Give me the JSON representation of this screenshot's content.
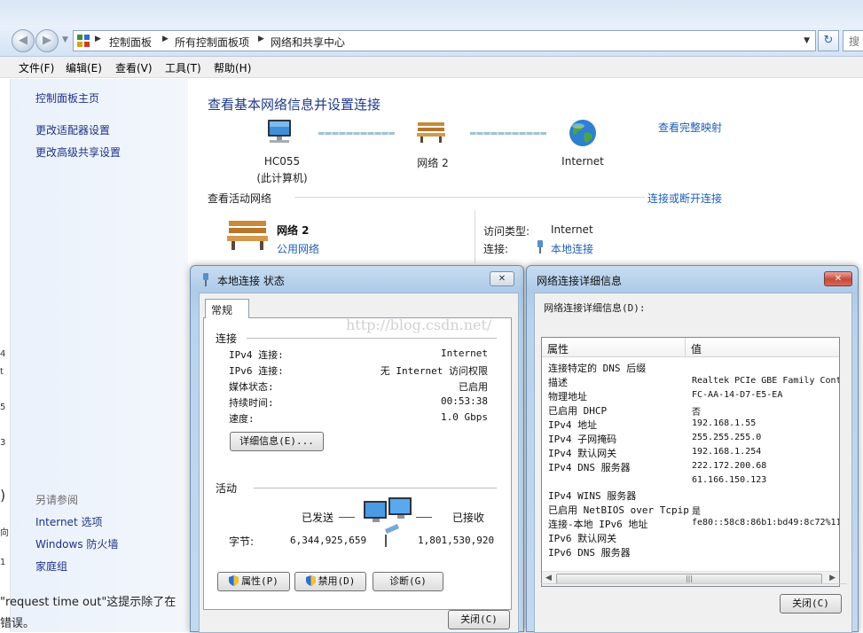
{
  "address": {
    "crumbs": [
      "控制面板",
      "所有控制面板项",
      "网络和共享中心"
    ],
    "search_placeholder": "搜"
  },
  "menu": [
    "文件(F)",
    "编辑(E)",
    "查看(V)",
    "工具(T)",
    "帮助(H)"
  ],
  "sidebar": {
    "links": [
      "控制面板主页",
      "更改适配器设置",
      "更改高级共享设置"
    ],
    "see_also_title": "另请参阅",
    "see_also": [
      "Internet 选项",
      "Windows 防火墙",
      "家庭组"
    ]
  },
  "main": {
    "title": "查看基本网络信息并设置连接",
    "full_map_link": "查看完整映射",
    "nodes": [
      {
        "line1": "HC055",
        "line2": "(此计算机)"
      },
      {
        "line1": "网络  2",
        "line2": ""
      },
      {
        "line1": "Internet",
        "line2": ""
      }
    ],
    "active_networks_label": "查看活动网络",
    "connect_link": "连接或断开连接",
    "network_name": "网络  2",
    "network_type": "公用网络",
    "access_type_label": "访问类型:",
    "access_type_value": "Internet",
    "connections_label": "连接:",
    "connections_value": "本地连接"
  },
  "blog_fragments": {
    "line1": "\"request time out\"这提示除了在",
    "line2": "错误。"
  },
  "status_dialog": {
    "title": "本地连接 状态",
    "close": "✕",
    "tab": "常规",
    "connection_group": "连接",
    "rows": [
      {
        "label": "IPv4 连接:",
        "value": "Internet"
      },
      {
        "label": "IPv6 连接:",
        "value": "无 Internet 访问权限"
      },
      {
        "label": "媒体状态:",
        "value": "已启用"
      },
      {
        "label": "持续时间:",
        "value": "00:53:38"
      },
      {
        "label": "速度:",
        "value": "1.0 Gbps"
      }
    ],
    "details_button": "详细信息(E)...",
    "activity_group": "活动",
    "sent_label": "已发送",
    "received_label": "已接收",
    "bytes_label": "字节:",
    "bytes_sent": "6,344,925,659",
    "bytes_received": "1,801,530,920",
    "properties_button": "属性(P)",
    "disable_button": "禁用(D)",
    "diagnose_button": "诊断(G)",
    "close_button": "关闭(C)"
  },
  "details_dialog": {
    "title": "网络连接详细信息",
    "list_label": "网络连接详细信息(D):",
    "col_property": "属性",
    "col_value": "值",
    "rows": [
      {
        "prop": "连接特定的 DNS 后缀",
        "val": ""
      },
      {
        "prop": "描述",
        "val": "Realtek PCIe GBE Family Cont"
      },
      {
        "prop": "物理地址",
        "val": "FC-AA-14-D7-E5-EA"
      },
      {
        "prop": "已启用 DHCP",
        "val": "否"
      },
      {
        "prop": "IPv4 地址",
        "val": "192.168.1.55"
      },
      {
        "prop": "IPv4 子网掩码",
        "val": "255.255.255.0"
      },
      {
        "prop": "IPv4 默认网关",
        "val": "192.168.1.254"
      },
      {
        "prop": "IPv4 DNS 服务器",
        "val": "222.172.200.68"
      },
      {
        "prop": "",
        "val": "61.166.150.123"
      },
      {
        "prop": "IPv4 WINS 服务器",
        "val": ""
      },
      {
        "prop": "已启用 NetBIOS over Tcpip",
        "val": "是"
      },
      {
        "prop": "连接-本地 IPv6 地址",
        "val": "fe80::58c8:86b1:bd49:8c72%11"
      },
      {
        "prop": "IPv6 默认网关",
        "val": ""
      },
      {
        "prop": "IPv6 DNS 服务器",
        "val": ""
      }
    ],
    "close_button": "关闭(C)"
  },
  "watermark": "http://blog.csdn.net/"
}
